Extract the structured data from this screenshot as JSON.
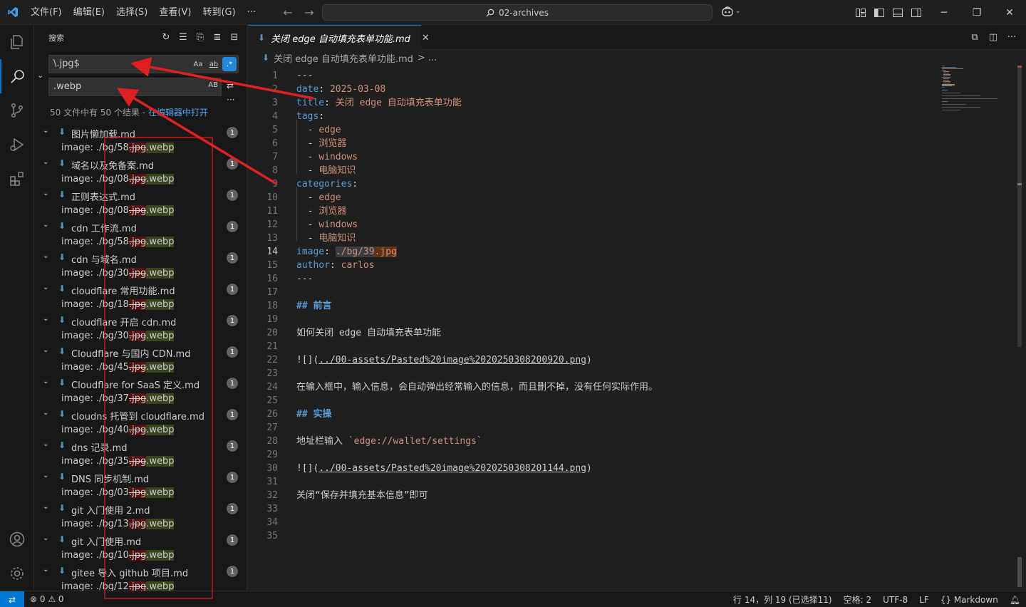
{
  "titlebar": {
    "menu": [
      "文件(F)",
      "编辑(E)",
      "选择(S)",
      "查看(V)",
      "转到(G)",
      "···"
    ],
    "command_center": "02-archives",
    "win_minimize": "─",
    "win_restore": "❐",
    "win_close": "✕"
  },
  "sidebar": {
    "title": "搜索",
    "search_value": "\\.jpg$",
    "opt_match_case": "Aa",
    "opt_whole_word": "ab",
    "opt_regex": ".*",
    "replace_value": ".webp",
    "opt_preserve_case": "AB",
    "summary_prefix": "50 文件中有 50 个结果 - ",
    "summary_link": "在编辑器中打开",
    "results": [
      {
        "file": "图片懒加载.md",
        "count": "1",
        "prefix": "image: ./bg/58",
        "del": ".jpg",
        "ins": ".webp"
      },
      {
        "file": "域名以及免备案.md",
        "count": "1",
        "prefix": "image: ./bg/08",
        "del": ".jpg",
        "ins": ".webp"
      },
      {
        "file": "正则表达式.md",
        "count": "1",
        "prefix": "image: ./bg/08",
        "del": ".jpg",
        "ins": ".webp"
      },
      {
        "file": "cdn 工作流.md",
        "count": "1",
        "prefix": "image: ./bg/58",
        "del": ".jpg",
        "ins": ".webp"
      },
      {
        "file": "cdn 与域名.md",
        "count": "1",
        "prefix": "image: ./bg/30",
        "del": ".jpg",
        "ins": ".webp"
      },
      {
        "file": "cloudflare 常用功能.md",
        "count": "1",
        "prefix": "image: ./bg/18",
        "del": ".jpg",
        "ins": ".webp"
      },
      {
        "file": "cloudflare 开启 cdn.md",
        "count": "1",
        "prefix": "image: ./bg/30",
        "del": ".jpg",
        "ins": ".webp"
      },
      {
        "file": "Cloudflare 与国内 CDN.md",
        "count": "1",
        "prefix": "image: ./bg/45",
        "del": ".jpg",
        "ins": ".webp"
      },
      {
        "file": "Cloudflare for SaaS 定义.md",
        "count": "1",
        "prefix": "image: ./bg/37",
        "del": ".jpg",
        "ins": ".webp"
      },
      {
        "file": "cloudns 托管到 cloudflare.md",
        "count": "1",
        "prefix": "image: ./bg/40",
        "del": ".jpg",
        "ins": ".webp"
      },
      {
        "file": "dns 记录.md",
        "count": "1",
        "prefix": "image: ./bg/35",
        "del": ".jpg",
        "ins": ".webp"
      },
      {
        "file": "DNS 同步机制.md",
        "count": "1",
        "prefix": "image: ./bg/03",
        "del": ".jpg",
        "ins": ".webp"
      },
      {
        "file": "git 入门使用 2.md",
        "count": "1",
        "prefix": "image: ./bg/13",
        "del": ".jpg",
        "ins": ".webp"
      },
      {
        "file": "git 入门使用.md",
        "count": "1",
        "prefix": "image: ./bg/10",
        "del": ".jpg",
        "ins": ".webp"
      },
      {
        "file": "gitee 导入 github 项目.md",
        "count": "1",
        "prefix": "image: ./bg/12",
        "del": ".jpg",
        "ins": ".webp"
      }
    ]
  },
  "editor": {
    "tab_label": "关闭 edge 自动填充表单功能.md",
    "tab_close": "✕",
    "breadcrumb_file": "关闭 edge 自动填充表单功能.md",
    "breadcrumb_more": "> ...",
    "lines": [
      {
        "n": "1",
        "parts": [
          [
            "",
            "---"
          ]
        ]
      },
      {
        "n": "2",
        "parts": [
          [
            "k",
            "date"
          ],
          [
            "",
            ": "
          ],
          [
            "s",
            "2025-03-08"
          ]
        ]
      },
      {
        "n": "3",
        "parts": [
          [
            "k",
            "title"
          ],
          [
            "",
            ": "
          ],
          [
            "s",
            "关闭 edge 自动填充表单功能"
          ]
        ]
      },
      {
        "n": "4",
        "parts": [
          [
            "k",
            "tags"
          ],
          [
            "",
            ":"
          ]
        ]
      },
      {
        "n": "5",
        "parts": [
          [
            "",
            "  - "
          ],
          [
            "s",
            "edge"
          ]
        ]
      },
      {
        "n": "6",
        "parts": [
          [
            "",
            "  - "
          ],
          [
            "s",
            "浏览器"
          ]
        ]
      },
      {
        "n": "7",
        "parts": [
          [
            "",
            "  - "
          ],
          [
            "s",
            "windows"
          ]
        ]
      },
      {
        "n": "8",
        "parts": [
          [
            "",
            "  - "
          ],
          [
            "s",
            "电脑知识"
          ]
        ]
      },
      {
        "n": "9",
        "parts": [
          [
            "k",
            "categories"
          ],
          [
            "",
            ":"
          ]
        ]
      },
      {
        "n": "10",
        "parts": [
          [
            "",
            "  - "
          ],
          [
            "s",
            "edge"
          ]
        ]
      },
      {
        "n": "11",
        "parts": [
          [
            "",
            "  - "
          ],
          [
            "s",
            "浏览器"
          ]
        ]
      },
      {
        "n": "12",
        "parts": [
          [
            "",
            "  - "
          ],
          [
            "s",
            "windows"
          ]
        ]
      },
      {
        "n": "13",
        "parts": [
          [
            "",
            "  - "
          ],
          [
            "s",
            "电脑知识"
          ]
        ]
      },
      {
        "n": "14",
        "parts": [
          [
            "k",
            "image"
          ],
          [
            "",
            ": "
          ],
          [
            "s hl2",
            "./bg/39"
          ],
          [
            "s hl",
            ".jpg"
          ]
        ]
      },
      {
        "n": "15",
        "parts": [
          [
            "k",
            "author"
          ],
          [
            "",
            ": "
          ],
          [
            "s",
            "carlos"
          ]
        ]
      },
      {
        "n": "16",
        "parts": [
          [
            "",
            "---"
          ]
        ]
      },
      {
        "n": "17",
        "parts": [
          [
            "",
            ""
          ]
        ]
      },
      {
        "n": "18",
        "parts": [
          [
            "h",
            "## 前言"
          ]
        ]
      },
      {
        "n": "19",
        "parts": [
          [
            "",
            ""
          ]
        ]
      },
      {
        "n": "20",
        "parts": [
          [
            "",
            "如何关闭 edge 自动填充表单功能"
          ]
        ]
      },
      {
        "n": "21",
        "parts": [
          [
            "",
            ""
          ]
        ]
      },
      {
        "n": "22",
        "parts": [
          [
            "",
            "![]("
          ],
          [
            "lk",
            "../00-assets/Pasted%20image%2020250308200920.png"
          ],
          [
            "",
            ")"
          ]
        ]
      },
      {
        "n": "23",
        "parts": [
          [
            "",
            ""
          ]
        ]
      },
      {
        "n": "24",
        "parts": [
          [
            "",
            "在输入框中，输入信息，会自动弹出经常输入的信息，而且删不掉，没有任何实际作用。"
          ]
        ]
      },
      {
        "n": "25",
        "parts": [
          [
            "",
            ""
          ]
        ]
      },
      {
        "n": "26",
        "parts": [
          [
            "h",
            "## 实操"
          ]
        ]
      },
      {
        "n": "27",
        "parts": [
          [
            "",
            ""
          ]
        ]
      },
      {
        "n": "28",
        "parts": [
          [
            "",
            "地址栏输入 "
          ],
          [
            "cb",
            "`edge://wallet/settings`"
          ]
        ]
      },
      {
        "n": "29",
        "parts": [
          [
            "",
            ""
          ]
        ]
      },
      {
        "n": "30",
        "parts": [
          [
            "",
            "![]("
          ],
          [
            "lk",
            "../00-assets/Pasted%20image%2020250308201144.png"
          ],
          [
            "",
            ")"
          ]
        ]
      },
      {
        "n": "31",
        "parts": [
          [
            "",
            ""
          ]
        ]
      },
      {
        "n": "32",
        "parts": [
          [
            "",
            "关闭“保存并填充基本信息”即可"
          ]
        ]
      },
      {
        "n": "33",
        "parts": [
          [
            "",
            ""
          ]
        ]
      },
      {
        "n": "34",
        "parts": [
          [
            "",
            ""
          ]
        ]
      },
      {
        "n": "35",
        "parts": [
          [
            "",
            ""
          ]
        ]
      }
    ]
  },
  "statusbar": {
    "problems": "⊗ 0 ⚠ 0",
    "position": "行 14，列 19 (已选择11)",
    "indent": "空格: 2",
    "encoding": "UTF-8",
    "eol": "LF",
    "language": "{} Markdown"
  },
  "colors": {
    "accent": "#0078d4",
    "annotation_red": "#e02020"
  }
}
